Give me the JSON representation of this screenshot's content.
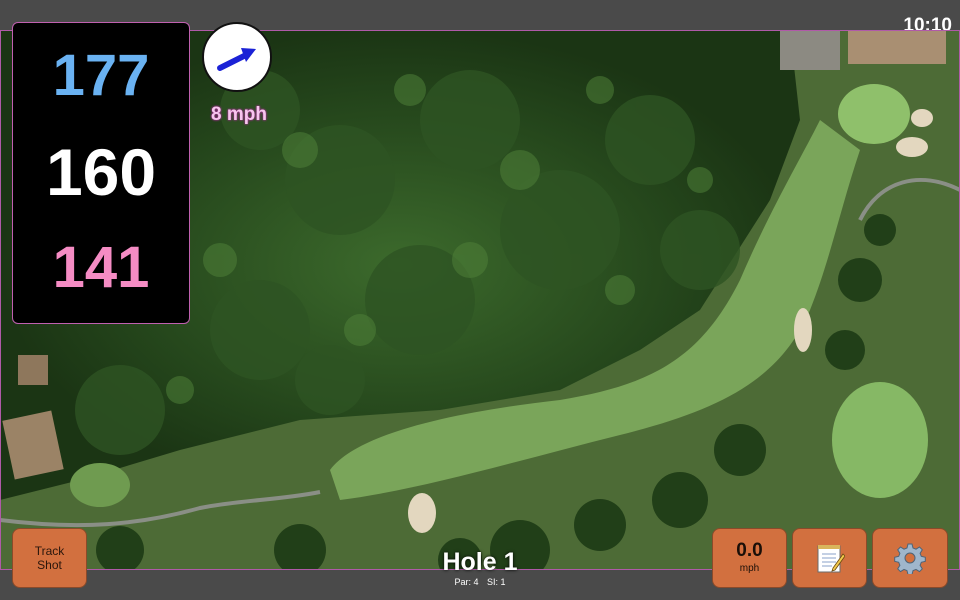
{
  "status_bar": {
    "time": "10:10"
  },
  "distances": {
    "back": "177",
    "center": "160",
    "front": "141"
  },
  "wind": {
    "speed_label": "8 mph",
    "direction_icon": "wind-arrow-icon"
  },
  "hole": {
    "title": "Hole 1",
    "par_label": "Par: 4",
    "si_label": "SI: 1"
  },
  "buttons": {
    "track_shot": {
      "line1": "Track",
      "line2": "Shot"
    },
    "speed": {
      "value": "0.0",
      "unit": "mph"
    },
    "notes_icon": "notepad-icon",
    "settings_icon": "gear-icon"
  },
  "colors": {
    "back_distance": "#6ab2f2",
    "center_distance": "#ffffff",
    "front_distance": "#f58cc4",
    "button_fill": "#d2703f",
    "wind_arrow": "#1b22d6"
  }
}
